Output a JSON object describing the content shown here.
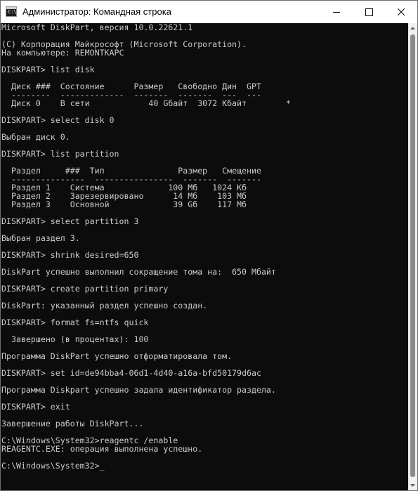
{
  "window": {
    "title": "Администратор: Командная строка",
    "icon_label": "C:\\."
  },
  "console": {
    "blocks": [
      [
        "Microsoft DiskPart, версия 10.0.22621.1"
      ],
      [
        "(C) Корпорация Майкрософт (Microsoft Corporation).",
        "На компьютере: REMONTKAPC"
      ],
      [
        "DISKPART> list disk"
      ],
      [
        "  Диск ###  Состояние      Размер   Свободно Дин  GPT",
        "  --------  -------------  -------  -------  ---  ---",
        "  Диск 0    В сети            40 Gбайт  3072 Kбайт        *"
      ],
      [
        "DISKPART> select disk 0"
      ],
      [
        "Выбран диск 0."
      ],
      [
        "DISKPART> list partition"
      ],
      [
        "  Раздел     ###  Тип               Размер   Смещение",
        "  ---------------  ----------------  -------  -------",
        "  Раздел 1    Система             100 Mб   1024 Kб",
        "  Раздел 2    Зарезервировано      14 Mб    103 Mб",
        "  Раздел 3    Основной             39 Gб    117 Mб"
      ],
      [
        "DISKPART> select partition 3"
      ],
      [
        "Выбран раздел 3."
      ],
      [
        "DISKPART> shrink desired=650"
      ],
      [
        "DiskPart успешно выполнил сокращение тома на:  650 Мбайт"
      ],
      [
        "DISKPART> create partition primary"
      ],
      [
        "DiskPart: указанный раздел успешно создан."
      ],
      [
        "DISKPART> format fs=ntfs quick"
      ],
      [
        "  Завершено (в процентах): 100"
      ],
      [
        "Программа DiskPart успешно отформатировала том."
      ],
      [
        "DISKPART> set id=de94bba4-06d1-4d40-a16a-bfd50179d6ac"
      ],
      [
        "Программа Diskpart успешно задала идентификатор раздела."
      ],
      [
        "DISKPART> exit"
      ],
      [
        "Завершение работы DiskPart..."
      ],
      [
        "C:\\Windows\\System32>reagentc /enable",
        "REAGENTC.EXE: операция выполнена успешно."
      ],
      [
        "C:\\Windows\\System32>_"
      ]
    ]
  },
  "icons": {
    "minimize": "minimize-icon",
    "maximize": "maximize-icon",
    "close": "close-icon",
    "scroll_up": "chevron-up-icon",
    "scroll_down": "chevron-down-icon"
  },
  "colors": {
    "console_bg": "#0c0c0c",
    "console_text": "#cccccc",
    "titlebar_bg": "#ffffff",
    "scrollbar_bg": "#f0f0f0"
  }
}
